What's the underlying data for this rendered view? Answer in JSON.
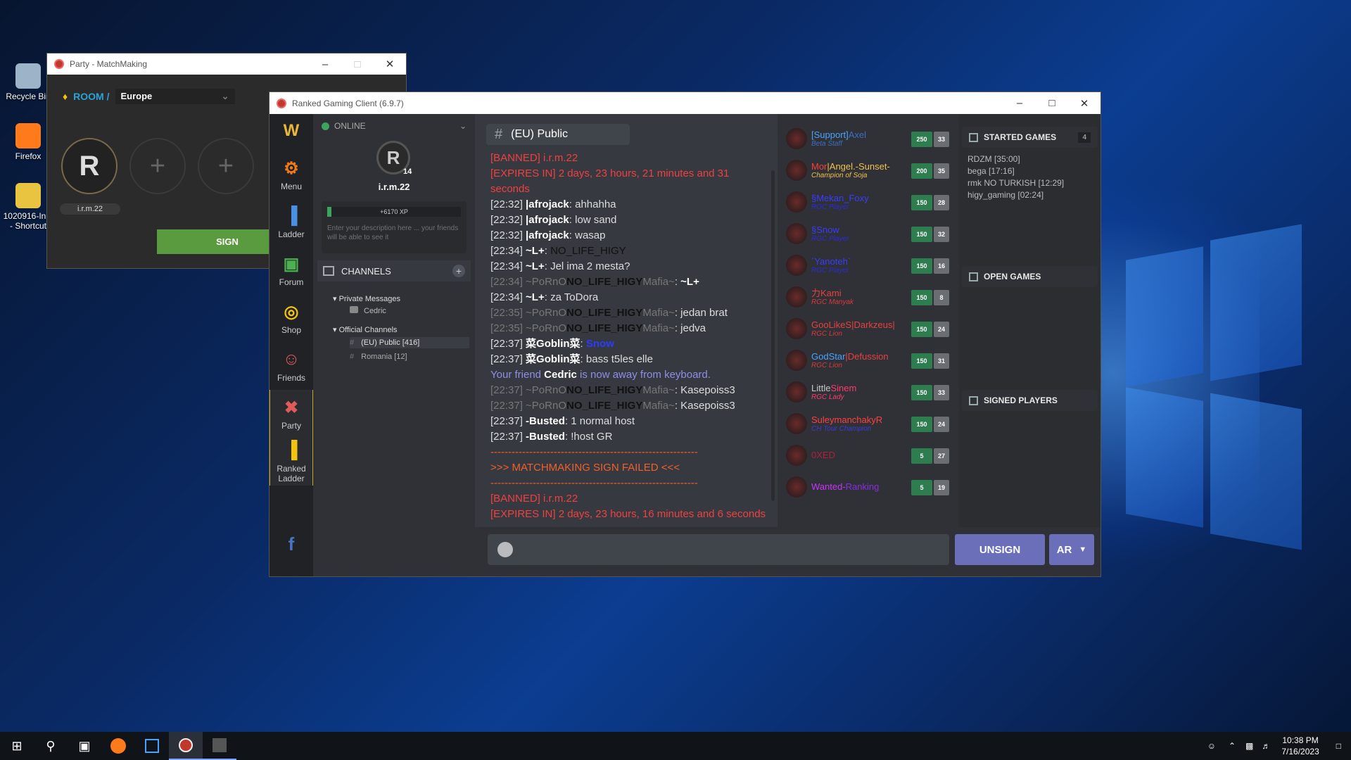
{
  "desktop": {
    "icons": [
      {
        "label": "Recycle Bin",
        "color": "#9db4c8"
      },
      {
        "label": "Firefox",
        "color": "#ff7a1a"
      },
      {
        "label": "1020916-In...\n- Shortcut",
        "color": "#e8c440"
      }
    ]
  },
  "party_window": {
    "title": "Party - MatchMaking",
    "room_label": "ROOM /",
    "region": "Europe",
    "player_name": "i.r.m.22",
    "sign_label": "SIGN"
  },
  "main_window": {
    "title": "Ranked Gaming Client (6.9.7)",
    "nav": [
      {
        "label": "",
        "icon": "w3-logo-icon",
        "color": "#e8b73a"
      },
      {
        "label": "Menu",
        "icon": "gear-icon",
        "color": "#f07b1d"
      },
      {
        "label": "Ladder",
        "icon": "bar-chart-icon",
        "color": "#4a90e2"
      },
      {
        "label": "Forum",
        "icon": "forum-icon",
        "color": "#4caf50"
      },
      {
        "label": "Shop",
        "icon": "coins-icon",
        "color": "#f1c40f"
      },
      {
        "label": "Friends",
        "icon": "friends-icon",
        "color": "#e05a5a"
      },
      {
        "label": "Party",
        "icon": "swords-icon",
        "color": "#e05a5a"
      },
      {
        "label": "Ranked\nLadder",
        "icon": "ranked-bars-icon",
        "color": "#f1c40f"
      }
    ],
    "facebook_label": "f",
    "profile": {
      "status": "ONLINE",
      "level": "14",
      "username": "i.r.m.22",
      "xp": "+6170 XP",
      "description_placeholder": "Enter your description here ... your friends will be able to see it"
    },
    "channels": {
      "title": "CHANNELS",
      "private_label": "Private Messages",
      "private_items": [
        "Cedric"
      ],
      "official_label": "Official Channels",
      "official_items": [
        "(EU) Public [416]",
        "Romania [12]"
      ]
    },
    "chat": {
      "channel": "(EU) Public",
      "messages": [
        {
          "parts": [
            {
              "t": "[BANNED] i.r.m.22",
              "c": "#f04040"
            }
          ]
        },
        {
          "parts": [
            {
              "t": "[EXPIRES IN] 2 days, 23 hours, 21 minutes and 31",
              "c": "#f04040"
            }
          ]
        },
        {
          "parts": [
            {
              "t": "seconds",
              "c": "#f04040"
            }
          ]
        },
        {
          "parts": [
            {
              "t": "[22:32] ",
              "c": "#dcddde"
            },
            {
              "t": "|afrojack",
              "c": "#ffffff",
              "b": true
            },
            {
              "t": ": ahhahha",
              "c": "#dcddde"
            }
          ]
        },
        {
          "parts": [
            {
              "t": "[22:32] ",
              "c": "#dcddde"
            },
            {
              "t": "|afrojack",
              "c": "#ffffff",
              "b": true
            },
            {
              "t": ": low sand",
              "c": "#dcddde"
            }
          ]
        },
        {
          "parts": [
            {
              "t": "[22:32] ",
              "c": "#dcddde"
            },
            {
              "t": "|afrojack",
              "c": "#ffffff",
              "b": true
            },
            {
              "t": ": wasap",
              "c": "#dcddde"
            }
          ]
        },
        {
          "parts": [
            {
              "t": "[22:34] ",
              "c": "#dcddde"
            },
            {
              "t": "~L+",
              "c": "#ffffff",
              "b": true
            },
            {
              "t": ": ",
              "c": "#dcddde"
            },
            {
              "t": "NO_LIFE_HIGY",
              "c": "#111111"
            }
          ]
        },
        {
          "parts": [
            {
              "t": "[22:34] ",
              "c": "#dcddde"
            },
            {
              "t": "~L+",
              "c": "#ffffff",
              "b": true
            },
            {
              "t": ": Jel ima 2 mesta?",
              "c": "#dcddde"
            }
          ]
        },
        {
          "parts": [
            {
              "t": "[22:34] ~PoRnO",
              "c": "#777777"
            },
            {
              "t": "NO_LIFE_HIGY",
              "c": "#111111",
              "b": true
            },
            {
              "t": "Mafia~",
              "c": "#777777"
            },
            {
              "t": ": ",
              "c": "#dcddde"
            },
            {
              "t": "~L+",
              "c": "#ffffff",
              "b": true
            }
          ]
        },
        {
          "parts": [
            {
              "t": "[22:34] ",
              "c": "#dcddde"
            },
            {
              "t": "~L+",
              "c": "#ffffff",
              "b": true
            },
            {
              "t": ": za ToDora",
              "c": "#dcddde"
            }
          ]
        },
        {
          "parts": [
            {
              "t": "[22:35] ~PoRnO",
              "c": "#777777"
            },
            {
              "t": "NO_LIFE_HIGY",
              "c": "#111111",
              "b": true
            },
            {
              "t": "Mafia~",
              "c": "#777777"
            },
            {
              "t": ": jedan brat",
              "c": "#dcddde"
            }
          ]
        },
        {
          "parts": [
            {
              "t": "[22:35] ~PoRnO",
              "c": "#777777"
            },
            {
              "t": "NO_LIFE_HIGY",
              "c": "#111111",
              "b": true
            },
            {
              "t": "Mafia~",
              "c": "#777777"
            },
            {
              "t": ": jedva",
              "c": "#dcddde"
            }
          ]
        },
        {
          "parts": [
            {
              "t": "[22:37] ",
              "c": "#dcddde"
            },
            {
              "t": "菜Goblin菜",
              "c": "#ffffff",
              "b": true
            },
            {
              "t": ": ",
              "c": "#dcddde"
            },
            {
              "t": "Snow",
              "c": "#2b3bff",
              "b": true
            }
          ]
        },
        {
          "parts": [
            {
              "t": "[22:37] ",
              "c": "#dcddde"
            },
            {
              "t": "菜Goblin菜",
              "c": "#ffffff",
              "b": true
            },
            {
              "t": ": bass t5les elle",
              "c": "#dcddde"
            }
          ]
        },
        {
          "parts": [
            {
              "t": "Your friend ",
              "c": "#8d8fe8"
            },
            {
              "t": "Cedric",
              "c": "#ffffff",
              "b": true
            },
            {
              "t": " is now away from keyboard.",
              "c": "#8d8fe8"
            }
          ]
        },
        {
          "parts": [
            {
              "t": "[22:37] ~PoRnO",
              "c": "#777777"
            },
            {
              "t": "NO_LIFE_HIGY",
              "c": "#111111",
              "b": true
            },
            {
              "t": "Mafia~",
              "c": "#777777"
            },
            {
              "t": ": Kasepoiss3",
              "c": "#dcddde"
            }
          ]
        },
        {
          "parts": [
            {
              "t": "[22:37] ~PoRnO",
              "c": "#777777"
            },
            {
              "t": "NO_LIFE_HIGY",
              "c": "#111111",
              "b": true
            },
            {
              "t": "Mafia~",
              "c": "#777777"
            },
            {
              "t": ": Kasepoiss3",
              "c": "#dcddde"
            }
          ]
        },
        {
          "parts": [
            {
              "t": "[22:37] ",
              "c": "#dcddde"
            },
            {
              "t": "-Busted",
              "c": "#ffffff",
              "b": true
            },
            {
              "t": ": 1 normal host",
              "c": "#dcddde"
            }
          ]
        },
        {
          "parts": [
            {
              "t": "[22:37] ",
              "c": "#dcddde"
            },
            {
              "t": "-Busted",
              "c": "#ffffff",
              "b": true
            },
            {
              "t": ": !host GR",
              "c": "#dcddde"
            }
          ]
        },
        {
          "parts": [
            {
              "t": "-----------------------------------------------------------",
              "c": "#f0602a"
            }
          ]
        },
        {
          "parts": [
            {
              "t": ">>> MATCHMAKING SIGN FAILED <<<",
              "c": "#f0602a"
            }
          ]
        },
        {
          "parts": [
            {
              "t": "-----------------------------------------------------------",
              "c": "#f0602a"
            }
          ]
        },
        {
          "parts": [
            {
              "t": "[BANNED] i.r.m.22",
              "c": "#f04040"
            }
          ]
        },
        {
          "parts": [
            {
              "t": "[EXPIRES IN] 2 days, 23 hours, 16 minutes and 6 seconds",
              "c": "#f04040"
            }
          ]
        }
      ]
    },
    "players": [
      {
        "name": "[Support]",
        "name2": "Axel",
        "c1": "#4aa3ff",
        "c2": "#3b6fc2",
        "title": "Beta Staff",
        "tc": "#3b6fc2",
        "score": "250",
        "count": "33"
      },
      {
        "name": "Mor",
        "name2": "|Angel.-Sunset-",
        "c1": "#ff3b3b",
        "c2": "#f2c14e",
        "title": "Champion of Soja",
        "tc": "#f2c14e",
        "score": "200",
        "count": "35"
      },
      {
        "name": "§Mekan_Foxy",
        "name2": "",
        "c1": "#3b3bff",
        "c2": "#3b3bff",
        "title": "RGC Player",
        "tc": "#2b2bdd",
        "score": "150",
        "count": "28"
      },
      {
        "name": "§Snow",
        "name2": "",
        "c1": "#3b3bff",
        "c2": "#3b3bff",
        "title": "RGC Player",
        "tc": "#2b2bdd",
        "score": "150",
        "count": "32"
      },
      {
        "name": "´Yanoteh`",
        "name2": "",
        "c1": "#3b3bff",
        "c2": "#3b3bff",
        "title": "RGC Player",
        "tc": "#2b2bdd",
        "score": "150",
        "count": "16"
      },
      {
        "name": "力Kami",
        "name2": "",
        "c1": "#e84040",
        "c2": "#e84040",
        "title": "RGC Manyak",
        "tc": "#d83a3a",
        "score": "150",
        "count": "8"
      },
      {
        "name": "GooLikeS",
        "name2": "|Darkzeus|",
        "c1": "#e84040",
        "c2": "#e84040",
        "title": "RGC Lion",
        "tc": "#d83a3a",
        "score": "150",
        "count": "24"
      },
      {
        "name": "GodStar",
        "name2": "|Defussion",
        "c1": "#4aa3ff",
        "c2": "#e84040",
        "title": "RGC Lion",
        "tc": "#d83a3a",
        "score": "150",
        "count": "31"
      },
      {
        "name": "Little",
        "name2": "Sinem",
        "c1": "#c8c8c8",
        "c2": "#ff3b6b",
        "title": "RGC Lady",
        "tc": "#ff3b6b",
        "score": "150",
        "count": "33"
      },
      {
        "name": "SuleymanchakyR",
        "name2": "",
        "c1": "#ff4040",
        "c2": "#ff4040",
        "title": "CH Tour Champion",
        "tc": "#3b3bdd",
        "score": "150",
        "count": "24"
      },
      {
        "name": "0XED",
        "name2": "",
        "c1": "#b0203a",
        "c2": "#b0203a",
        "title": "",
        "tc": "#b0203a",
        "score": "5",
        "count": "27"
      },
      {
        "name": "Wanted-",
        "name2": "Ranking",
        "c1": "#cc33ff",
        "c2": "#8a2be2",
        "title": "",
        "tc": "#8a2be2",
        "score": "5",
        "count": "19"
      }
    ],
    "started_games": {
      "title": "STARTED GAMES",
      "count": "4",
      "items": [
        "RDZM [35:00]",
        "bega [17:16]",
        "rmk NO TURKISH [12:29]",
        "higy_gaming [02:24]"
      ]
    },
    "open_games_title": "OPEN GAMES",
    "signed_players_title": "SIGNED PLAYERS",
    "unsign_label": "UNSIGN",
    "lang_label": "AR"
  },
  "taskbar": {
    "time": "10:38 PM",
    "date": "7/16/2023"
  }
}
